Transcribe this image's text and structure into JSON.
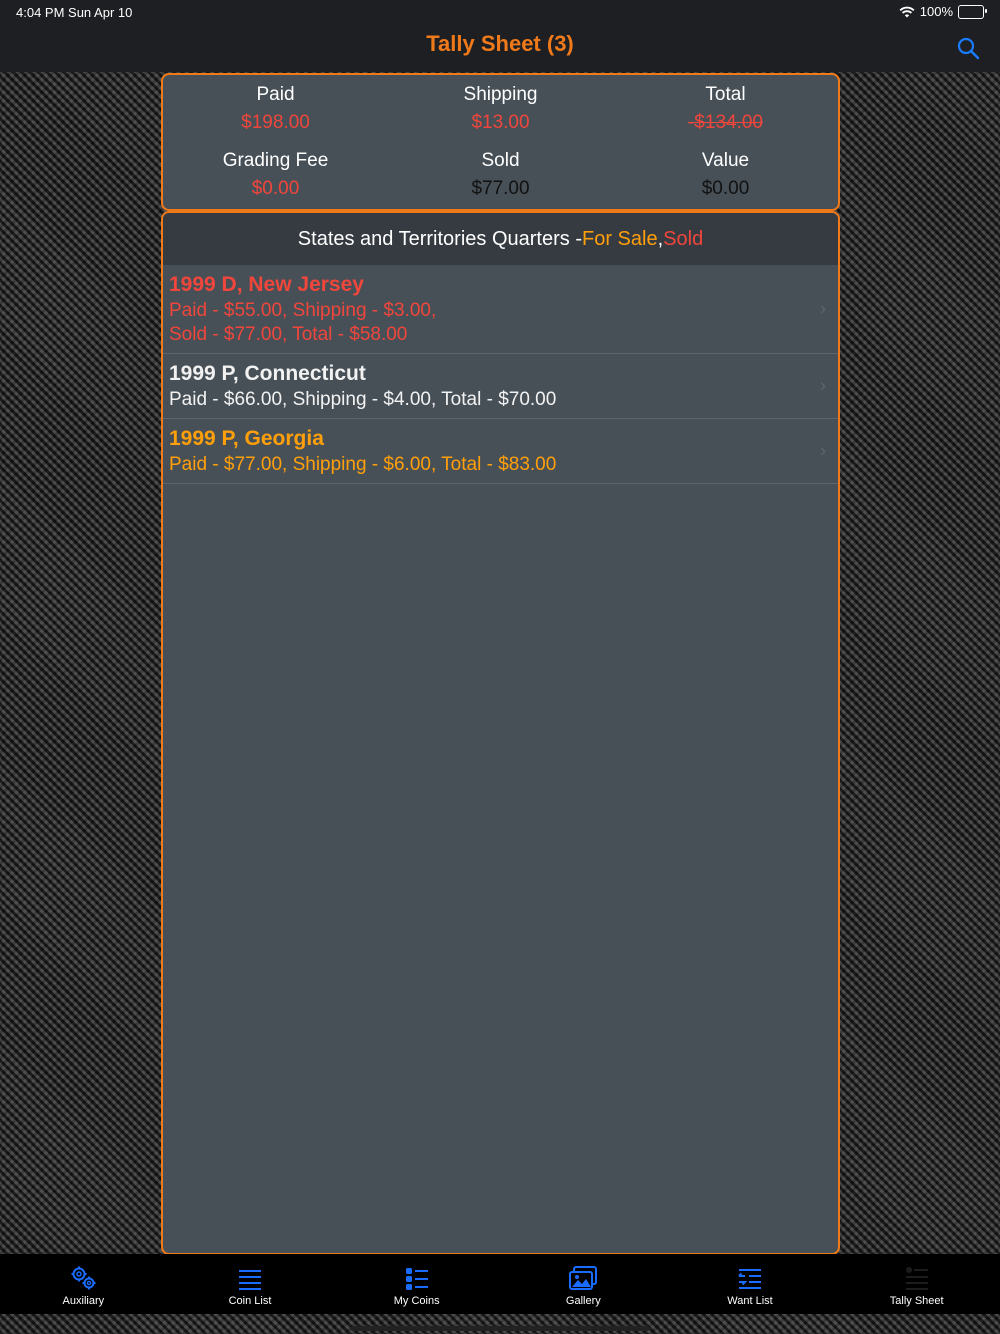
{
  "status": {
    "time": "4:04 PM   Sun Apr 10",
    "battery": "100%"
  },
  "nav": {
    "title": "Tally Sheet (3)",
    "search_icon": "search-icon"
  },
  "summary": {
    "paid_label": "Paid",
    "paid_value": "$198.00",
    "shipping_label": "Shipping",
    "shipping_value": "$13.00",
    "total_label": "Total",
    "total_value": "-$134.00",
    "grading_label": "Grading Fee",
    "grading_value": "$0.00",
    "sold_label": "Sold",
    "sold_value": "$77.00",
    "value_label": "Value",
    "value_value": "$0.00"
  },
  "list": {
    "header_prefix": "States and Territories Quarters - ",
    "header_for_sale": "For Sale",
    "header_sep": ",",
    "header_sold": " Sold",
    "items": [
      {
        "title": "1999 D, New Jersey",
        "line1": "Paid - $55.00, Shipping - $3.00,",
        "line2": "Sold - $77.00, Total - $58.00"
      },
      {
        "title": "1999 P, Connecticut",
        "line1": "Paid - $66.00, Shipping - $4.00, Total - $70.00"
      },
      {
        "title": "1999 P, Georgia",
        "line1": "Paid - $77.00, Shipping - $6.00, Total - $83.00"
      }
    ]
  },
  "tabs": [
    {
      "label": "Auxiliary",
      "icon": "gears-icon"
    },
    {
      "label": "Coin List",
      "icon": "list-icon"
    },
    {
      "label": "My Coins",
      "icon": "bullet-list-icon"
    },
    {
      "label": "Gallery",
      "icon": "photos-icon"
    },
    {
      "label": "Want List",
      "icon": "want-list-icon"
    },
    {
      "label": "Tally Sheet",
      "icon": "tally-icon"
    }
  ],
  "colors": {
    "accent": "#f07a1a",
    "tab_active": "#1a6cff",
    "sold_red": "#f0463c",
    "for_sale_orange": "#ff9f0a"
  }
}
